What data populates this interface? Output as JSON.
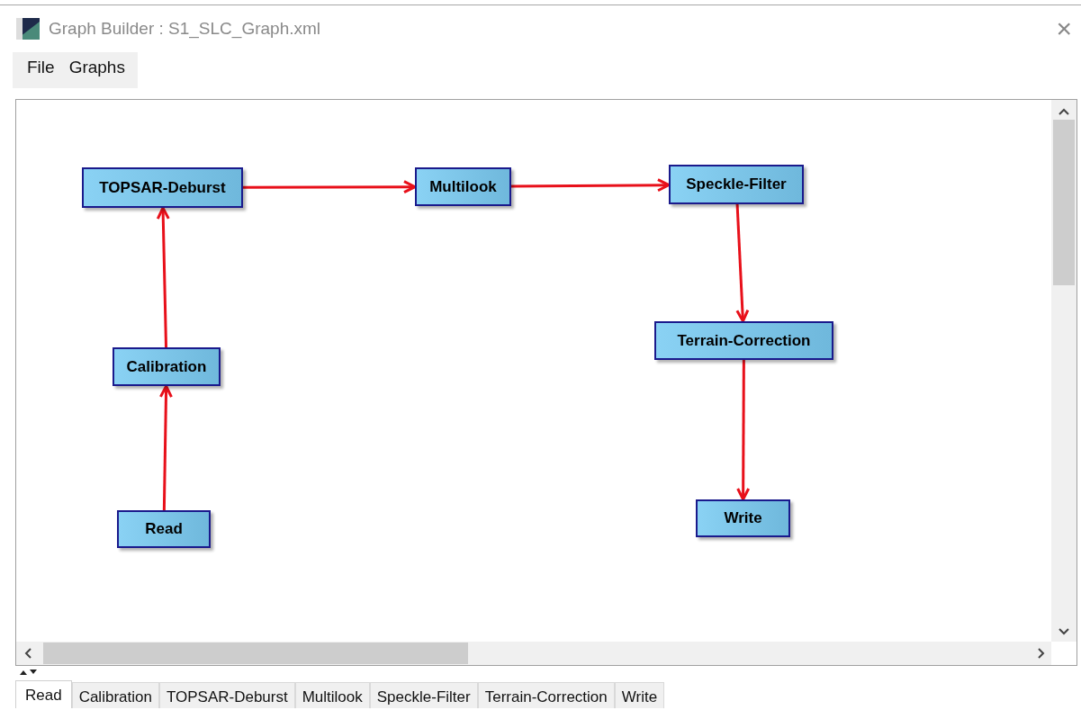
{
  "window": {
    "title": "Graph Builder : S1_SLC_Graph.xml",
    "close": "×"
  },
  "menu": [
    {
      "label": "File"
    },
    {
      "label": "Graphs"
    }
  ],
  "nodes": [
    {
      "label": "TOPSAR-Deburst"
    },
    {
      "label": "Multilook"
    },
    {
      "label": "Speckle-Filter"
    },
    {
      "label": "Terrain-Correction"
    },
    {
      "label": "Calibration"
    },
    {
      "label": "Write"
    },
    {
      "label": "Read"
    }
  ],
  "tabs": [
    {
      "label": "Read",
      "selected": true
    },
    {
      "label": "Calibration",
      "selected": false
    },
    {
      "label": "TOPSAR-Deburst",
      "selected": false
    },
    {
      "label": "Multilook",
      "selected": false
    },
    {
      "label": "Speckle-Filter",
      "selected": false
    },
    {
      "label": "Terrain-Correction",
      "selected": false
    },
    {
      "label": "Write",
      "selected": false
    }
  ]
}
